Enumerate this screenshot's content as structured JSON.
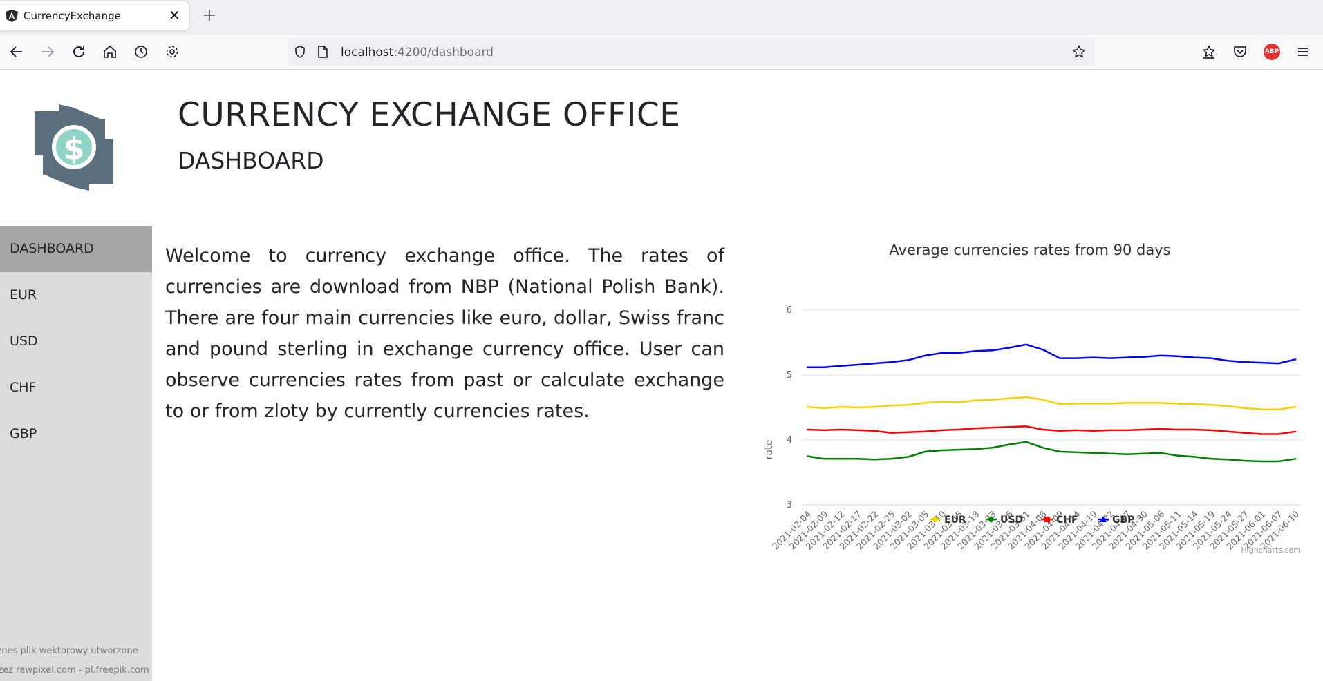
{
  "browser": {
    "tab_title": "CurrencyExchange",
    "url_host": "localhost",
    "url_path": ":4200/dashboard",
    "adblock_label": "ABP"
  },
  "header": {
    "title": "CURRENCY EXCHANGE OFFICE",
    "subtitle": "DASHBOARD"
  },
  "sidebar": {
    "items": [
      {
        "label": "DASHBOARD",
        "active": true
      },
      {
        "label": "EUR",
        "active": false
      },
      {
        "label": "USD",
        "active": false
      },
      {
        "label": "CHF",
        "active": false
      },
      {
        "label": "GBP",
        "active": false
      }
    ],
    "credit_line1": "iznes plik wektorowy utworzone",
    "credit_line2": "rzez rawpixel.com - pl.freepik.com"
  },
  "main": {
    "welcome_text": "Welcome to currency exchange office. The rates of currencies are download from NBP (National Polish Bank). There are four main currencies like euro, dollar, Swiss franc and pound sterling in exchange currency office. User can observe currencies rates from past or calculate exchange to or from zloty by currently currencies rates."
  },
  "chart_data": {
    "type": "line",
    "title": "Average currencies rates from 90 days",
    "ylabel": "rate",
    "xlabel": "",
    "ylim": [
      3,
      6
    ],
    "yticks": [
      3,
      4,
      5,
      6
    ],
    "grid": true,
    "legend_placement": "bottom-center",
    "credits": "Highcharts.com",
    "x_tick_labels": [
      "2021-02-04",
      "2021-02-09",
      "2021-02-12",
      "2021-02-17",
      "2021-02-22",
      "2021-02-25",
      "2021-03-02",
      "2021-03-05",
      "2021-03-10",
      "2021-03-15",
      "2021-03-18",
      "2021-03-23",
      "2021-03-26",
      "2021-03-31",
      "2021-04-06",
      "2021-04-09",
      "2021-04-14",
      "2021-04-19",
      "2021-04-22",
      "2021-04-27",
      "2021-04-30",
      "2021-05-06",
      "2021-05-11",
      "2021-05-14",
      "2021-05-19",
      "2021-05-24",
      "2021-05-27",
      "2021-06-01",
      "2021-06-07",
      "2021-06-10"
    ],
    "series": [
      {
        "name": "EUR",
        "color": "#f5d000",
        "marker": "circle",
        "values": [
          4.51,
          4.49,
          4.51,
          4.5,
          4.51,
          4.53,
          4.54,
          4.57,
          4.59,
          4.58,
          4.61,
          4.62,
          4.64,
          4.66,
          4.62,
          4.55,
          4.56,
          4.56,
          4.56,
          4.57,
          4.57,
          4.57,
          4.56,
          4.55,
          4.54,
          4.52,
          4.49,
          4.47,
          4.47,
          4.51
        ]
      },
      {
        "name": "USD",
        "color": "#008000",
        "marker": "diamond",
        "values": [
          3.75,
          3.71,
          3.71,
          3.71,
          3.7,
          3.71,
          3.74,
          3.82,
          3.84,
          3.85,
          3.86,
          3.88,
          3.93,
          3.97,
          3.88,
          3.82,
          3.81,
          3.8,
          3.79,
          3.78,
          3.79,
          3.8,
          3.76,
          3.74,
          3.71,
          3.7,
          3.68,
          3.67,
          3.67,
          3.71
        ]
      },
      {
        "name": "CHF",
        "color": "#ff0000",
        "marker": "square",
        "values": [
          4.16,
          4.15,
          4.16,
          4.15,
          4.14,
          4.11,
          4.12,
          4.13,
          4.15,
          4.16,
          4.18,
          4.19,
          4.2,
          4.21,
          4.16,
          4.14,
          4.15,
          4.14,
          4.15,
          4.15,
          4.16,
          4.17,
          4.16,
          4.16,
          4.15,
          4.13,
          4.11,
          4.09,
          4.09,
          4.13
        ]
      },
      {
        "name": "GBP",
        "color": "#0000ff",
        "marker": "triangle",
        "values": [
          5.12,
          5.12,
          5.14,
          5.16,
          5.18,
          5.2,
          5.23,
          5.3,
          5.34,
          5.34,
          5.37,
          5.38,
          5.42,
          5.47,
          5.39,
          5.26,
          5.26,
          5.27,
          5.26,
          5.27,
          5.28,
          5.3,
          5.29,
          5.27,
          5.26,
          5.22,
          5.2,
          5.19,
          5.18,
          5.24
        ]
      }
    ]
  }
}
